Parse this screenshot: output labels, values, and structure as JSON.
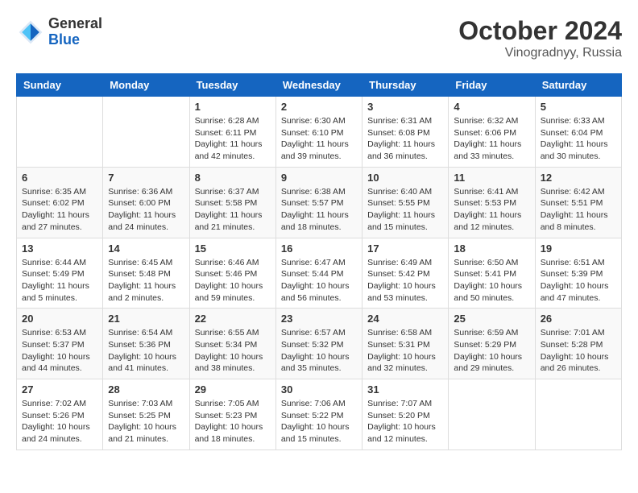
{
  "header": {
    "logo": {
      "general": "General",
      "blue": "Blue"
    },
    "title": "October 2024",
    "subtitle": "Vinogradnyy, Russia"
  },
  "weekdays": [
    "Sunday",
    "Monday",
    "Tuesday",
    "Wednesday",
    "Thursday",
    "Friday",
    "Saturday"
  ],
  "weeks": [
    [
      {
        "day": null,
        "info": null
      },
      {
        "day": null,
        "info": null
      },
      {
        "day": "1",
        "info": "Sunrise: 6:28 AM\nSunset: 6:11 PM\nDaylight: 11 hours and 42 minutes."
      },
      {
        "day": "2",
        "info": "Sunrise: 6:30 AM\nSunset: 6:10 PM\nDaylight: 11 hours and 39 minutes."
      },
      {
        "day": "3",
        "info": "Sunrise: 6:31 AM\nSunset: 6:08 PM\nDaylight: 11 hours and 36 minutes."
      },
      {
        "day": "4",
        "info": "Sunrise: 6:32 AM\nSunset: 6:06 PM\nDaylight: 11 hours and 33 minutes."
      },
      {
        "day": "5",
        "info": "Sunrise: 6:33 AM\nSunset: 6:04 PM\nDaylight: 11 hours and 30 minutes."
      }
    ],
    [
      {
        "day": "6",
        "info": "Sunrise: 6:35 AM\nSunset: 6:02 PM\nDaylight: 11 hours and 27 minutes."
      },
      {
        "day": "7",
        "info": "Sunrise: 6:36 AM\nSunset: 6:00 PM\nDaylight: 11 hours and 24 minutes."
      },
      {
        "day": "8",
        "info": "Sunrise: 6:37 AM\nSunset: 5:58 PM\nDaylight: 11 hours and 21 minutes."
      },
      {
        "day": "9",
        "info": "Sunrise: 6:38 AM\nSunset: 5:57 PM\nDaylight: 11 hours and 18 minutes."
      },
      {
        "day": "10",
        "info": "Sunrise: 6:40 AM\nSunset: 5:55 PM\nDaylight: 11 hours and 15 minutes."
      },
      {
        "day": "11",
        "info": "Sunrise: 6:41 AM\nSunset: 5:53 PM\nDaylight: 11 hours and 12 minutes."
      },
      {
        "day": "12",
        "info": "Sunrise: 6:42 AM\nSunset: 5:51 PM\nDaylight: 11 hours and 8 minutes."
      }
    ],
    [
      {
        "day": "13",
        "info": "Sunrise: 6:44 AM\nSunset: 5:49 PM\nDaylight: 11 hours and 5 minutes."
      },
      {
        "day": "14",
        "info": "Sunrise: 6:45 AM\nSunset: 5:48 PM\nDaylight: 11 hours and 2 minutes."
      },
      {
        "day": "15",
        "info": "Sunrise: 6:46 AM\nSunset: 5:46 PM\nDaylight: 10 hours and 59 minutes."
      },
      {
        "day": "16",
        "info": "Sunrise: 6:47 AM\nSunset: 5:44 PM\nDaylight: 10 hours and 56 minutes."
      },
      {
        "day": "17",
        "info": "Sunrise: 6:49 AM\nSunset: 5:42 PM\nDaylight: 10 hours and 53 minutes."
      },
      {
        "day": "18",
        "info": "Sunrise: 6:50 AM\nSunset: 5:41 PM\nDaylight: 10 hours and 50 minutes."
      },
      {
        "day": "19",
        "info": "Sunrise: 6:51 AM\nSunset: 5:39 PM\nDaylight: 10 hours and 47 minutes."
      }
    ],
    [
      {
        "day": "20",
        "info": "Sunrise: 6:53 AM\nSunset: 5:37 PM\nDaylight: 10 hours and 44 minutes."
      },
      {
        "day": "21",
        "info": "Sunrise: 6:54 AM\nSunset: 5:36 PM\nDaylight: 10 hours and 41 minutes."
      },
      {
        "day": "22",
        "info": "Sunrise: 6:55 AM\nSunset: 5:34 PM\nDaylight: 10 hours and 38 minutes."
      },
      {
        "day": "23",
        "info": "Sunrise: 6:57 AM\nSunset: 5:32 PM\nDaylight: 10 hours and 35 minutes."
      },
      {
        "day": "24",
        "info": "Sunrise: 6:58 AM\nSunset: 5:31 PM\nDaylight: 10 hours and 32 minutes."
      },
      {
        "day": "25",
        "info": "Sunrise: 6:59 AM\nSunset: 5:29 PM\nDaylight: 10 hours and 29 minutes."
      },
      {
        "day": "26",
        "info": "Sunrise: 7:01 AM\nSunset: 5:28 PM\nDaylight: 10 hours and 26 minutes."
      }
    ],
    [
      {
        "day": "27",
        "info": "Sunrise: 7:02 AM\nSunset: 5:26 PM\nDaylight: 10 hours and 24 minutes."
      },
      {
        "day": "28",
        "info": "Sunrise: 7:03 AM\nSunset: 5:25 PM\nDaylight: 10 hours and 21 minutes."
      },
      {
        "day": "29",
        "info": "Sunrise: 7:05 AM\nSunset: 5:23 PM\nDaylight: 10 hours and 18 minutes."
      },
      {
        "day": "30",
        "info": "Sunrise: 7:06 AM\nSunset: 5:22 PM\nDaylight: 10 hours and 15 minutes."
      },
      {
        "day": "31",
        "info": "Sunrise: 7:07 AM\nSunset: 5:20 PM\nDaylight: 10 hours and 12 minutes."
      },
      {
        "day": null,
        "info": null
      },
      {
        "day": null,
        "info": null
      }
    ]
  ]
}
